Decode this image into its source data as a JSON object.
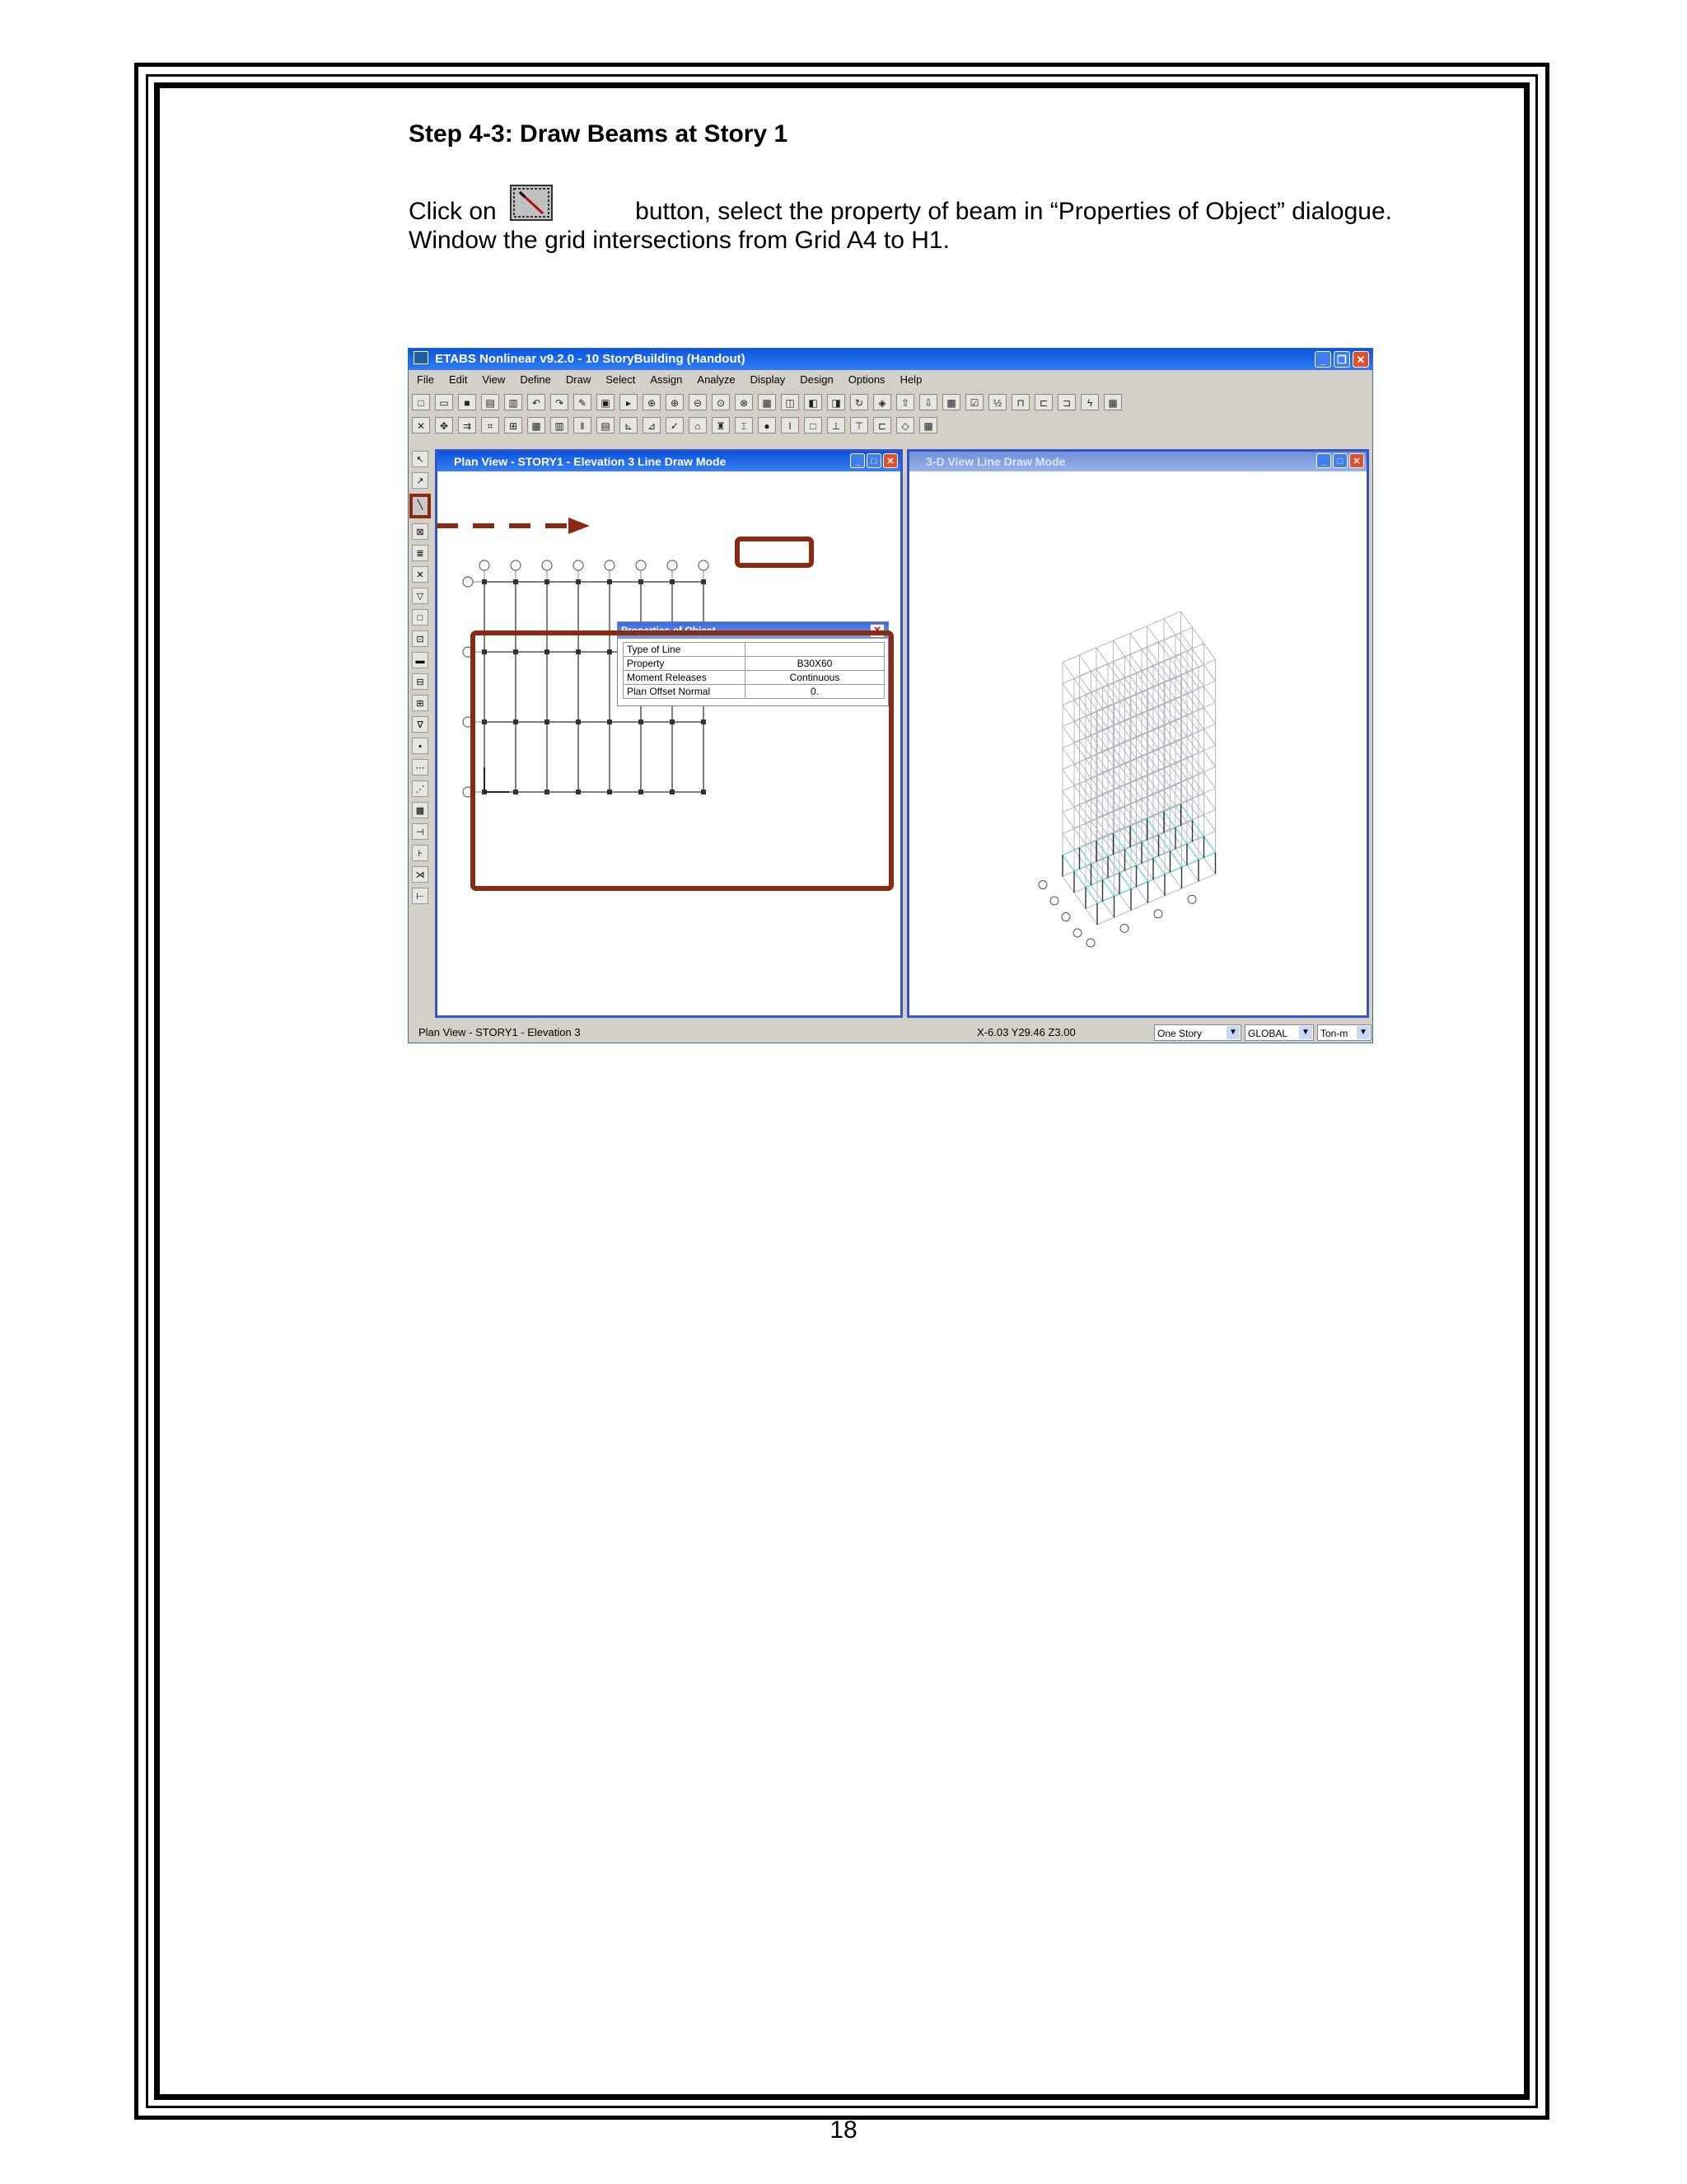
{
  "page": {
    "step_title": "Step 4-3: Draw Beams at Story 1",
    "instruction": {
      "line1_before_icon": "Click on",
      "line1_after_icon": "button, select the property of beam in “Properties of Object” dialogue.",
      "line2": "Window the grid intersections from Grid A4 to H1."
    },
    "page_number": "18"
  },
  "app": {
    "title": "ETABS Nonlinear v9.2.0 - 10 StoryBuilding (Handout)",
    "menu": [
      "File",
      "Edit",
      "View",
      "Define",
      "Draw",
      "Select",
      "Assign",
      "Analyze",
      "Display",
      "Design",
      "Options",
      "Help"
    ],
    "plan_window_title": "Plan View - STORY1 - Elevation 3 Line Draw Mode",
    "view3d_window_title": "3-D View Line Draw Mode",
    "properties_dialog": {
      "title": "Properties of Object",
      "rows": [
        {
          "label": "Type of Line",
          "value": ""
        },
        {
          "label": "Property",
          "value": "B30X60"
        },
        {
          "label": "Moment Releases",
          "value": "Continuous"
        },
        {
          "label": "Plan Offset Normal",
          "value": "0."
        }
      ]
    },
    "status": {
      "left": "Plan View - STORY1 - Elevation 3",
      "coords": "X-6.03  Y29.46  Z3.00",
      "story_combo": "One Story",
      "coord_combo": "GLOBAL",
      "units_combo": "Ton-m"
    },
    "colors": {
      "title_blue": "#0a55dd",
      "highlight_red": "#8b2a12",
      "slab_cyan": "#7fdcd8"
    }
  }
}
